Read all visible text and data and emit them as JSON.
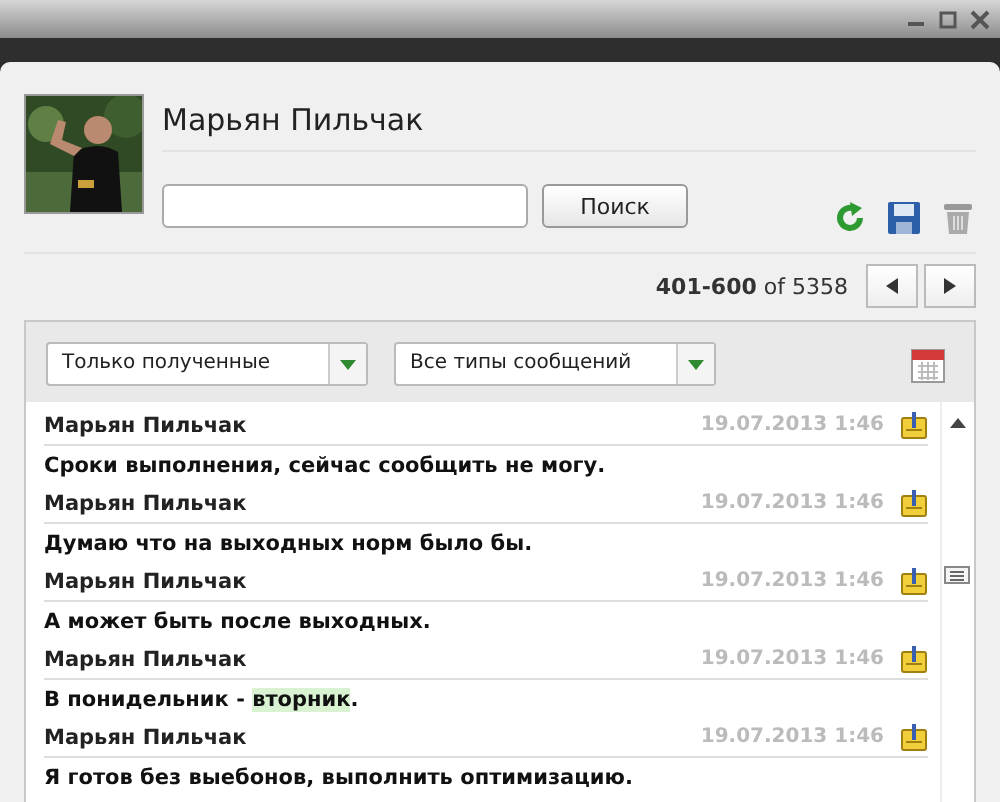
{
  "contact": {
    "name": "Марьян Пильчак"
  },
  "search": {
    "button": "Поиск"
  },
  "pagination": {
    "range": "401-600",
    "of": "of",
    "total": "5358"
  },
  "filters": [
    {
      "value": "Только полученные"
    },
    {
      "value": "Все типы сообщений"
    }
  ],
  "messages": [
    {
      "author": "Марьян Пильчак",
      "time": "19.07.2013 1:46",
      "parts": [
        {
          "text": "Сроки выполнения, сейчас сообщить не могу.",
          "highlighted": false
        }
      ]
    },
    {
      "author": "Марьян Пильчак",
      "time": "19.07.2013 1:46",
      "parts": [
        {
          "text": "Думаю что на выходных норм было бы.",
          "highlighted": false
        }
      ]
    },
    {
      "author": "Марьян Пильчак",
      "time": "19.07.2013 1:46",
      "parts": [
        {
          "text": "А может быть после выходных.",
          "highlighted": false
        }
      ]
    },
    {
      "author": "Марьян Пильчак",
      "time": "19.07.2013 1:46",
      "parts": [
        {
          "text": "В понидельник - ",
          "highlighted": false
        },
        {
          "text": "вторник",
          "highlighted": true
        },
        {
          "text": ".",
          "highlighted": false
        }
      ]
    },
    {
      "author": "Марьян Пильчак",
      "time": "19.07.2013 1:46",
      "parts": [
        {
          "text": "Я готов без выебонов, выполнить оптимизацию.",
          "highlighted": false
        }
      ]
    }
  ]
}
